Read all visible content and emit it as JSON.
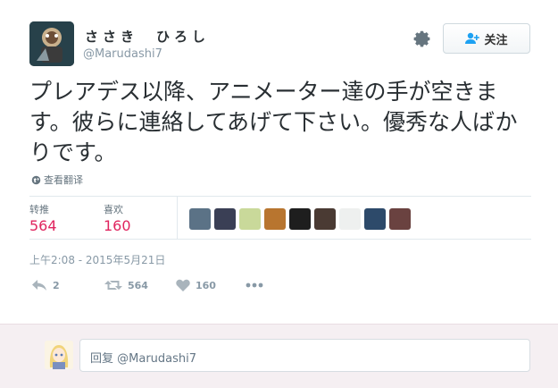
{
  "tweet": {
    "display_name": "ささき　ひろし",
    "handle": "@Marudashi7",
    "text": "プレアデス以降、アニメーター達の手が空きます。彼らに連絡してあげて下さい。優秀な人ばかりです。",
    "translate_label": "查看翻译",
    "timestamp": "上午2:08 - 2015年5月21日"
  },
  "follow_button": {
    "label": "关注",
    "icon": "add-user-icon"
  },
  "stats": {
    "retweets_label": "转推",
    "retweets_count": "564",
    "likes_label": "喜欢",
    "likes_count": "160"
  },
  "likers": [
    {
      "color": "#5b7286"
    },
    {
      "color": "#3a3f55"
    },
    {
      "color": "#c9d99a"
    },
    {
      "color": "#b8752f"
    },
    {
      "color": "#1e1e1e"
    },
    {
      "color": "#4a3a33"
    },
    {
      "color": "#eef0ef"
    },
    {
      "color": "#2d4a6a"
    },
    {
      "color": "#6a4240"
    }
  ],
  "actions": {
    "reply_count": "2",
    "retweet_count": "564",
    "like_count": "160",
    "more_icon": "more-dots-icon"
  },
  "reply": {
    "placeholder": "回复 @Marudashi7"
  },
  "colors": {
    "accent_pink": "#e0245e",
    "muted": "#8899a6",
    "reply_bg": "#f5eff2"
  }
}
